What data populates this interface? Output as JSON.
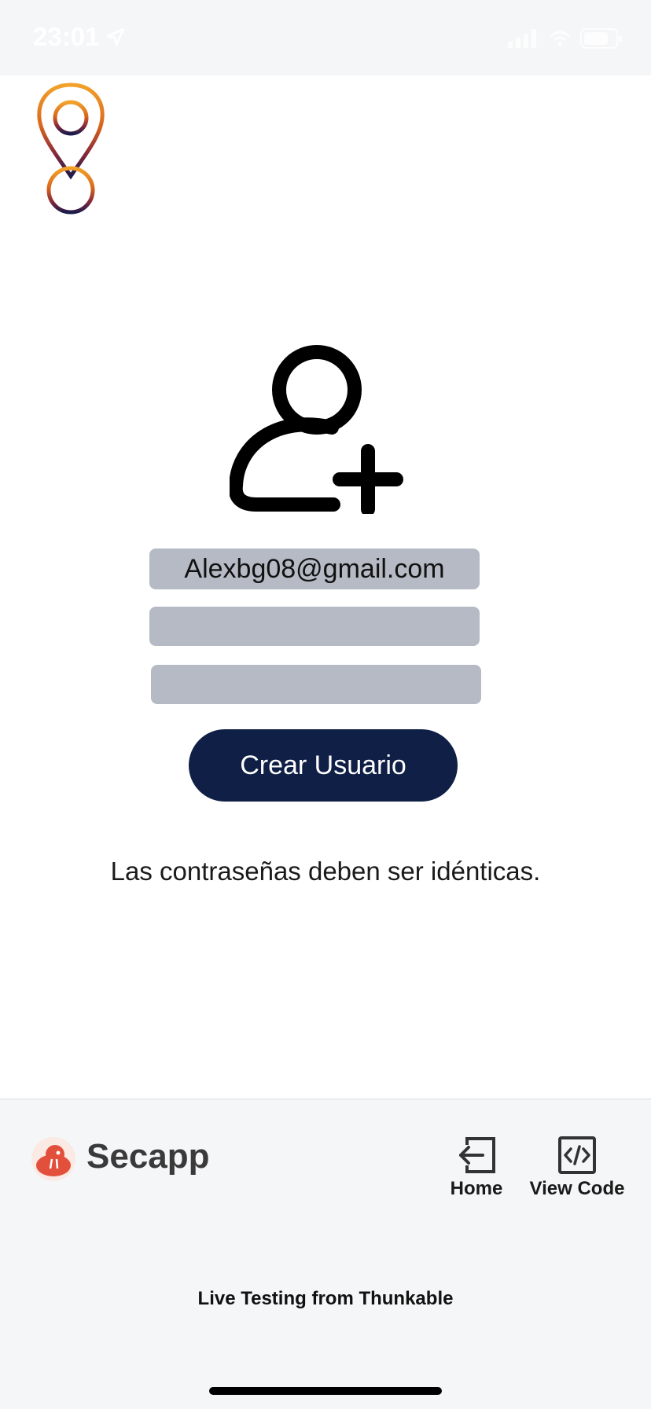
{
  "status_bar": {
    "time": "23:01"
  },
  "form": {
    "email_value": "Alexbg08@gmail.com",
    "password_value": "",
    "confirm_password_value": "",
    "create_button_label": "Crear Usuario",
    "message": "Las contraseñas deben ser idénticas."
  },
  "bottom_bar": {
    "app_name": "Secapp",
    "home_label": "Home",
    "view_code_label": "View Code",
    "footer": "Live Testing from Thunkable"
  },
  "colors": {
    "button_bg": "#0f1f45",
    "field_bg": "#b5bac4",
    "panel_bg": "#f5f6f8"
  },
  "icons": {
    "logo": "location-pin-icon",
    "add_user": "add-user-icon",
    "home": "home-exit-icon",
    "view_code": "code-icon"
  }
}
